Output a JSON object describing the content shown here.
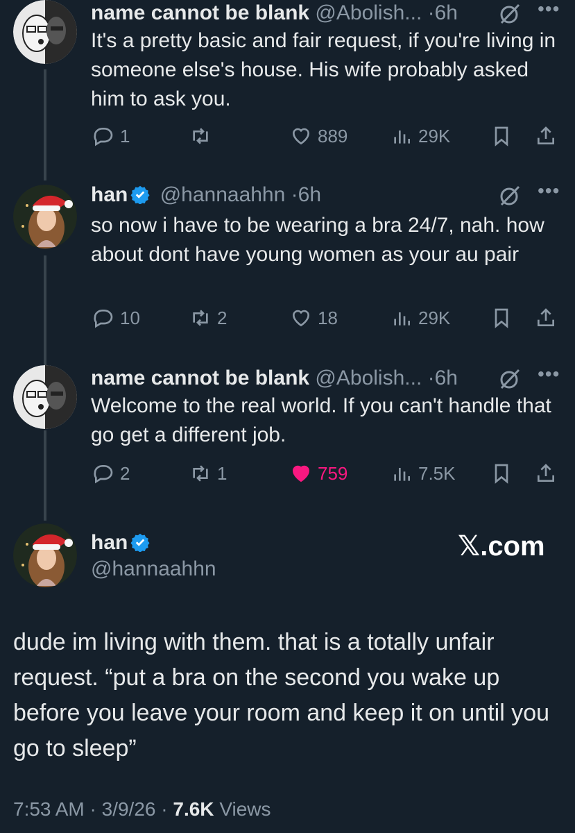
{
  "tweets": [
    {
      "name": "name cannot be blank",
      "handle": "@Abolish...",
      "dot": "·",
      "time": "6h",
      "text": "It's a pretty basic and fair request, if you're living in someone else's house. His wife probably asked him to ask you.",
      "replies": "1",
      "retweets": "",
      "likes": "889",
      "views": "29K",
      "liked": false,
      "verified": false
    },
    {
      "name": "han",
      "handle": "@hannaahhn",
      "dot": "·",
      "time": "6h",
      "text": "so now i have to be wearing a bra 24/7, nah. how about dont have young women as your au pair",
      "replies": "10",
      "retweets": "2",
      "likes": "18",
      "views": "29K",
      "liked": false,
      "verified": true
    },
    {
      "name": "name cannot be blank",
      "handle": "@Abolish...",
      "dot": "·",
      "time": "6h",
      "text": "Welcome to the real world. If you can't handle that go get a different job.",
      "replies": "2",
      "retweets": "1",
      "likes": "759",
      "views": "7.5K",
      "liked": true,
      "verified": false
    }
  ],
  "main_tweet": {
    "name": "han",
    "handle": "@hannaahhn",
    "watermark_x": "𝕏",
    "watermark_domain": ".com",
    "text": "dude im living with them. that is a totally unfair request. “put a bra on the second you wake up before you leave your room and keep it on until you go to sleep”",
    "time": "7:53 AM",
    "sep1": "·",
    "date": "3/9/26",
    "sep2": "·",
    "views_count": "7.6K",
    "views_label": "Views"
  },
  "colors": {
    "background": "#15202b",
    "text": "#e7e9ea",
    "muted": "#8b98a5",
    "like": "#f91880",
    "verified": "#1d9bf0",
    "thread_line": "#38444d"
  },
  "icons": [
    "reply-icon",
    "retweet-icon",
    "like-icon",
    "views-icon",
    "bookmark-icon",
    "share-icon",
    "grok-icon",
    "more-icon",
    "verified-badge-icon"
  ]
}
